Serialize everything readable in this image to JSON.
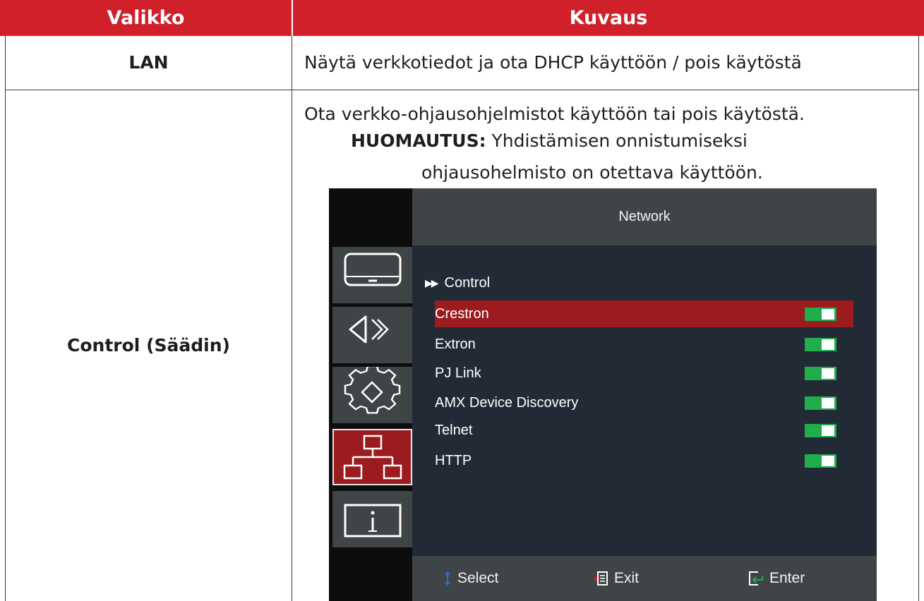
{
  "table": {
    "headers": {
      "menu": "Valikko",
      "description": "Kuvaus"
    },
    "rows": [
      {
        "menu": "LAN",
        "description": "Näytä verkkotiedot ja ota DHCP käyttöön / pois käytöstä"
      },
      {
        "menu": "Control (Säädin)",
        "description": "Ota verkko-ohjausohjelmistot käyttöön tai pois käytöstä.",
        "note_label": "HUOMAUTUS:",
        "note_line1": " Yhdistämisen onnistumiseksi",
        "note_line2": "ohjausohelmisto on otettava käyttöön."
      }
    ]
  },
  "osd": {
    "title": "Network",
    "section": "Control",
    "selected_index": 0,
    "items": [
      {
        "label": "Crestron",
        "enabled": true
      },
      {
        "label": "Extron",
        "enabled": true
      },
      {
        "label": "PJ Link",
        "enabled": true
      },
      {
        "label": "AMX Device Discovery",
        "enabled": true
      },
      {
        "label": "Telnet",
        "enabled": true
      },
      {
        "label": "HTTP",
        "enabled": true
      }
    ],
    "tabs": [
      "display-icon",
      "audio-icon",
      "settings-icon",
      "network-icon",
      "info-icon"
    ],
    "active_tab": "network-icon",
    "footer": {
      "select": "Select",
      "exit": "Exit",
      "enter": "Enter"
    },
    "colors": {
      "selected_row": "#9b1b1f",
      "toggle_on": "#1fae4b",
      "background": "#222b35"
    }
  },
  "colors": {
    "header": "#d0202a"
  }
}
